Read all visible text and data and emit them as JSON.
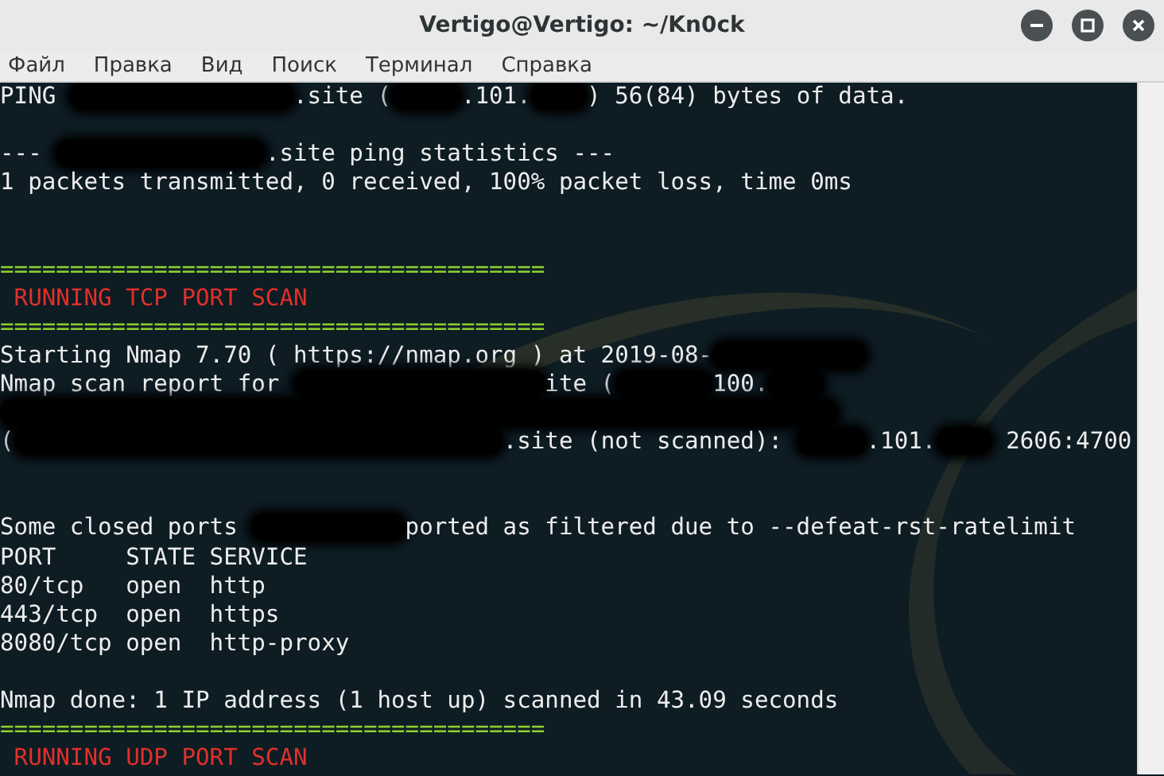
{
  "window": {
    "title": "Vertigo@Vertigo: ~/Kn0ck"
  },
  "menu": [
    "Файл",
    "Правка",
    "Вид",
    "Поиск",
    "Терминал",
    "Справка"
  ],
  "terminal": {
    "lines": [
      {
        "kind": "output",
        "segments": [
          {
            "kind": "text",
            "text": "PING "
          },
          {
            "kind": "redacted"
          },
          {
            "kind": "text",
            "text": ".site ("
          },
          {
            "kind": "redacted"
          },
          {
            "kind": "text",
            "text": ".101."
          },
          {
            "kind": "redacted"
          },
          {
            "kind": "text",
            "text": ") 56(84) bytes of data."
          }
        ]
      },
      {
        "kind": "blank"
      },
      {
        "kind": "output",
        "segments": [
          {
            "kind": "text",
            "text": "--- "
          },
          {
            "kind": "redacted"
          },
          {
            "kind": "text",
            "text": ".site ping statistics ---"
          }
        ]
      },
      {
        "kind": "output",
        "segments": [
          {
            "kind": "text",
            "text": "1 packets transmitted, 0 received, 100% packet loss, time 0ms"
          }
        ]
      },
      {
        "kind": "blank"
      },
      {
        "kind": "blank"
      },
      {
        "kind": "rule",
        "segments": [
          {
            "kind": "text",
            "text": "======================================="
          }
        ]
      },
      {
        "kind": "heading",
        "segments": [
          {
            "kind": "text",
            "text": " RUNNING TCP PORT SCAN"
          }
        ]
      },
      {
        "kind": "rule",
        "segments": [
          {
            "kind": "text",
            "text": "======================================="
          }
        ]
      },
      {
        "kind": "output",
        "segments": [
          {
            "kind": "text",
            "text": "Starting Nmap 7.70 ( https://nmap.org ) at 2019-08-"
          },
          {
            "kind": "redacted"
          }
        ]
      },
      {
        "kind": "output",
        "segments": [
          {
            "kind": "text",
            "text": "Nmap scan report for "
          },
          {
            "kind": "redacted"
          },
          {
            "kind": "text",
            "text": "ite ("
          },
          {
            "kind": "redacted"
          },
          {
            "kind": "text",
            "text": "100."
          },
          {
            "kind": "redacted"
          }
        ]
      },
      {
        "kind": "output",
        "segments": [
          {
            "kind": "redacted"
          }
        ]
      },
      {
        "kind": "output",
        "segments": [
          {
            "kind": "text",
            "text": "("
          },
          {
            "kind": "redacted"
          },
          {
            "kind": "text",
            "text": ".site (not scanned): "
          },
          {
            "kind": "redacted"
          },
          {
            "kind": "text",
            "text": ".101."
          },
          {
            "kind": "redacted"
          },
          {
            "kind": "text",
            "text": " 2606:4700"
          }
        ]
      },
      {
        "kind": "blank"
      },
      {
        "kind": "blank"
      },
      {
        "kind": "output",
        "segments": [
          {
            "kind": "text",
            "text": "Some closed ports "
          },
          {
            "kind": "redacted"
          },
          {
            "kind": "text",
            "text": "ported as filtered due to --defeat-rst-ratelimit"
          }
        ]
      },
      {
        "kind": "output",
        "segments": [
          {
            "kind": "text",
            "text": "PORT     STATE SERVICE"
          }
        ]
      },
      {
        "kind": "output",
        "segments": [
          {
            "kind": "text",
            "text": "80/tcp   open  http"
          }
        ]
      },
      {
        "kind": "output",
        "segments": [
          {
            "kind": "text",
            "text": "443/tcp  open  https"
          }
        ]
      },
      {
        "kind": "output",
        "segments": [
          {
            "kind": "text",
            "text": "8080/tcp open  http-proxy"
          }
        ]
      },
      {
        "kind": "blank"
      },
      {
        "kind": "output",
        "segments": [
          {
            "kind": "text",
            "text": "Nmap done: 1 IP address (1 host up) scanned in 43.09 seconds"
          }
        ]
      },
      {
        "kind": "rule",
        "segments": [
          {
            "kind": "text",
            "text": "======================================="
          }
        ]
      },
      {
        "kind": "heading",
        "segments": [
          {
            "kind": "text",
            "text": " RUNNING UDP PORT SCAN"
          }
        ]
      }
    ]
  }
}
